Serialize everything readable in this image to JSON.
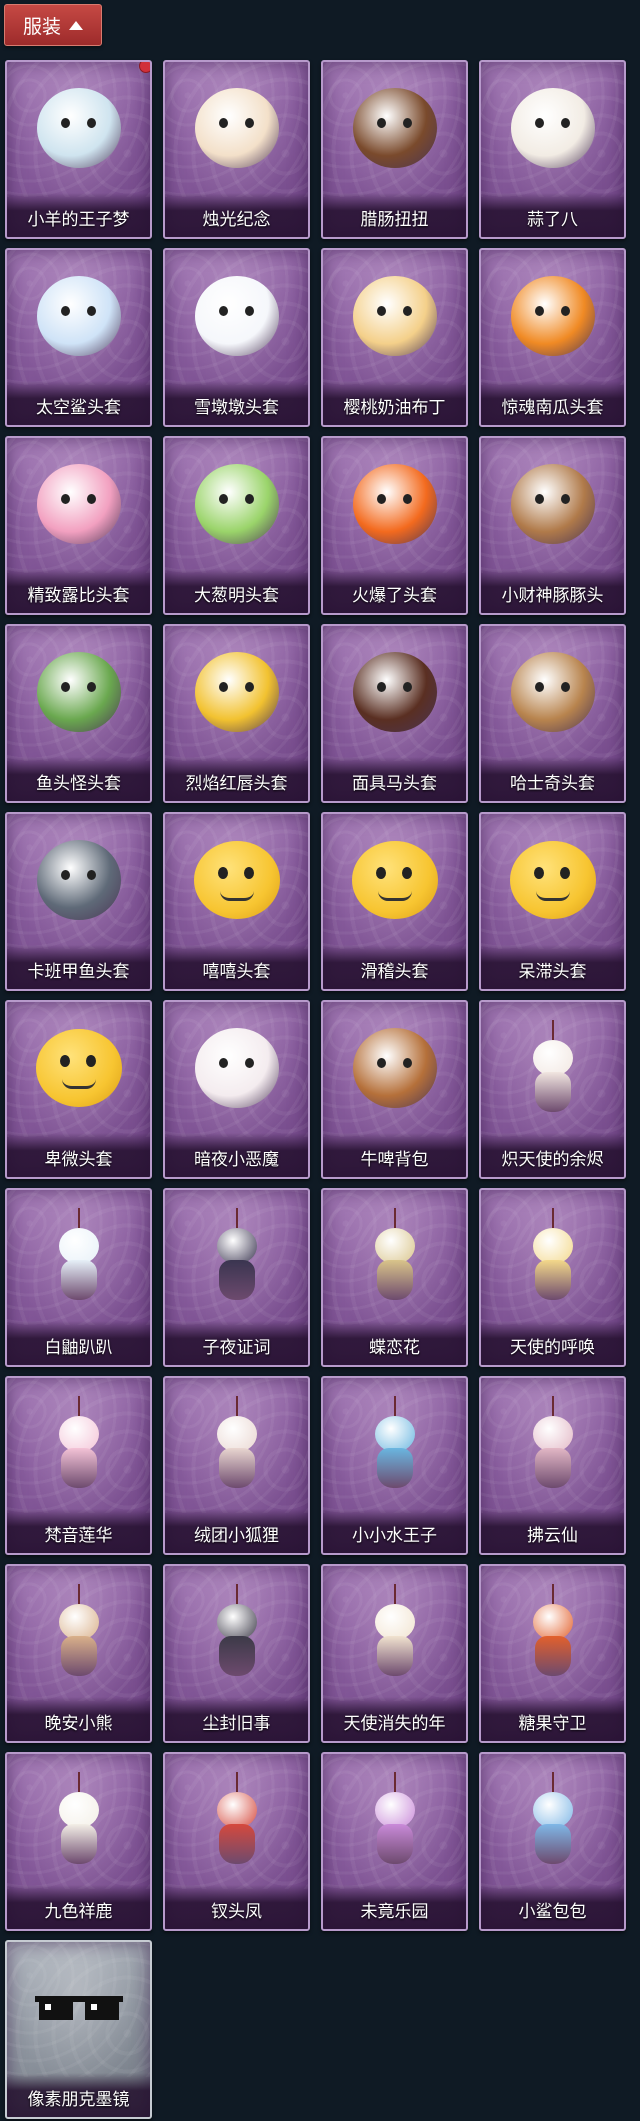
{
  "header": {
    "title": "服装",
    "toggle_icon": "chevron-up-icon"
  },
  "items": [
    {
      "label": "小羊的王子梦",
      "icon": "sheep-prince-icon",
      "color": "#cfe4ef",
      "has_badge": true
    },
    {
      "label": "烛光纪念",
      "icon": "candle-icon",
      "color": "#f3e0c9"
    },
    {
      "label": "腊肠扭扭",
      "icon": "dachshund-icon",
      "color": "#7a4a2c"
    },
    {
      "label": "蒜了八",
      "icon": "garlic-icon",
      "color": "#f2ece4"
    },
    {
      "label": "太空鲨头套",
      "icon": "space-shark-icon",
      "color": "#cfe3f7"
    },
    {
      "label": "雪墩墩头套",
      "icon": "snowman-icon",
      "color": "#f5f7fb"
    },
    {
      "label": "樱桃奶油布丁",
      "icon": "pudding-icon",
      "color": "#f4d08a"
    },
    {
      "label": "惊魂南瓜头套",
      "icon": "pumpkin-icon",
      "color": "#f08a24"
    },
    {
      "label": "精致露比头套",
      "icon": "ruby-icon",
      "color": "#f2a0c0"
    },
    {
      "label": "大葱明头套",
      "icon": "scallion-icon",
      "color": "#9ad46a"
    },
    {
      "label": "火爆了头套",
      "icon": "fire-icon",
      "color": "#f36a1e"
    },
    {
      "label": "小财神豚豚头",
      "icon": "capybara-icon",
      "color": "#b07a4a"
    },
    {
      "label": "鱼头怪头套",
      "icon": "fish-head-icon",
      "color": "#6aa84f"
    },
    {
      "label": "烈焰红唇头套",
      "icon": "pikachu-icon",
      "color": "#f2c230"
    },
    {
      "label": "面具马头套",
      "icon": "horse-mask-icon",
      "color": "#5a2f22"
    },
    {
      "label": "哈士奇头套",
      "icon": "husky-icon",
      "color": "#b8844e"
    },
    {
      "label": "卡班甲鱼头套",
      "icon": "whale-icon",
      "color": "#5f6a78"
    },
    {
      "label": "嘻嘻头套",
      "icon": "grin-emoji-icon",
      "color": "#f7c531"
    },
    {
      "label": "滑稽头套",
      "icon": "smirk-emoji-icon",
      "color": "#f7c531"
    },
    {
      "label": "呆滞头套",
      "icon": "dazed-emoji-icon",
      "color": "#f7c531"
    },
    {
      "label": "卑微头套",
      "icon": "humble-emoji-icon",
      "color": "#f7c531"
    },
    {
      "label": "暗夜小恶魔",
      "icon": "devil-icon",
      "color": "#f4ecef"
    },
    {
      "label": "牛啤背包",
      "icon": "beer-barrel-icon",
      "color": "#b5703a"
    },
    {
      "label": "炽天使的余烬",
      "icon": "angel-doll-icon",
      "color": "#f1e6e0"
    },
    {
      "label": "白鼬趴趴",
      "icon": "ermine-icon",
      "color": "#e6f0f8"
    },
    {
      "label": "子夜证词",
      "icon": "owl-witness-icon",
      "color": "#3a3550"
    },
    {
      "label": "蝶恋花",
      "icon": "butterfly-pendant-icon",
      "color": "#d9c48a"
    },
    {
      "label": "天使的呼唤",
      "icon": "angel-call-icon",
      "color": "#f3d88a"
    },
    {
      "label": "梵音莲华",
      "icon": "lotus-doll-icon",
      "color": "#f3c2d6"
    },
    {
      "label": "绒团小狐狸",
      "icon": "fox-pendant-icon",
      "color": "#e9d6d0"
    },
    {
      "label": "小小水王子",
      "icon": "water-prince-icon",
      "color": "#6ab6e0"
    },
    {
      "label": "拂云仙",
      "icon": "cloud-fairy-icon",
      "color": "#e2b7c5"
    },
    {
      "label": "晚安小熊",
      "icon": "bear-pendant-icon",
      "color": "#d9b08a"
    },
    {
      "label": "尘封旧事",
      "icon": "dusty-doll-icon",
      "color": "#3c3a48"
    },
    {
      "label": "天使消失的年",
      "icon": "lost-angel-icon",
      "color": "#f1e3cf"
    },
    {
      "label": "糖果守卫",
      "icon": "candy-guard-icon",
      "color": "#e2602c"
    },
    {
      "label": "九色祥鹿",
      "icon": "deer-icon",
      "color": "#f3efe6"
    },
    {
      "label": "钗头凤",
      "icon": "phoenix-crown-icon",
      "color": "#d5493d"
    },
    {
      "label": "未竟乐园",
      "icon": "paradise-doll-icon",
      "color": "#c98ad9"
    },
    {
      "label": "小鲨包包",
      "icon": "shark-bag-icon",
      "color": "#7fb7e6"
    },
    {
      "label": "像素朋克墨镜",
      "icon": "pixel-sunglasses-icon",
      "color": "#111111",
      "grey": true
    }
  ]
}
